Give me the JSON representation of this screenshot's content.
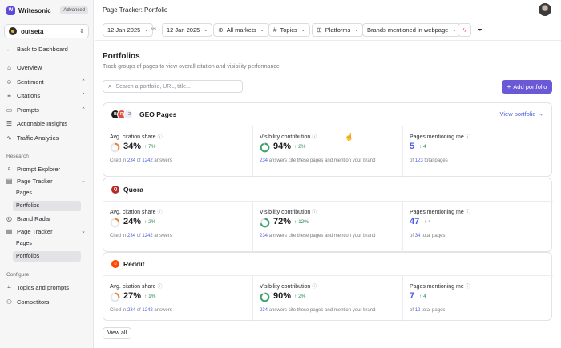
{
  "app": {
    "name": "Writesonic",
    "plan_badge": "Advanced",
    "workspace": "outseta"
  },
  "sidebar": {
    "back": "Back to Dashboard",
    "items": [
      {
        "label": "Overview",
        "icon": "home-icon"
      },
      {
        "label": "Sentiment",
        "icon": "sentiment-icon",
        "expandable": true
      },
      {
        "label": "Citations",
        "icon": "citations-icon",
        "expandable": true
      },
      {
        "label": "Prompts",
        "icon": "prompts-icon",
        "expandable": true
      },
      {
        "label": "Actionable Insights",
        "icon": "insights-icon"
      },
      {
        "label": "Traffic Analytics",
        "icon": "analytics-icon"
      }
    ],
    "research_title": "Research",
    "research_items": [
      {
        "label": "Prompt Explorer",
        "icon": "explorer-icon"
      },
      {
        "label": "Page Tracker",
        "icon": "tracker-icon",
        "expandable": true,
        "children": [
          "Pages",
          "Portfolios"
        ]
      },
      {
        "label": "Brand Radar",
        "icon": "radar-icon"
      },
      {
        "label": "Page Tracker",
        "icon": "tracker-icon",
        "expandable": true,
        "children": [
          "Pages",
          "Portfolios"
        ]
      }
    ],
    "configure_title": "Configure",
    "configure_items": [
      {
        "label": "Topics and prompts",
        "icon": "topics-icon"
      },
      {
        "label": "Competitors",
        "icon": "competitors-icon"
      }
    ]
  },
  "header": {
    "breadcrumb": "Page Tracker: Portfolio"
  },
  "filters": {
    "date_from": "12 Jan 2025",
    "vs_label": "vs.",
    "date_to": "12 Jan 2025",
    "markets": "All markets",
    "topics": "Topics",
    "platforms": "Platforms",
    "brands": "Brands mentioned in webpage"
  },
  "main": {
    "title": "Portfolios",
    "subtitle": "Track groups of pages to view overall citation and visibility performance",
    "search_placeholder": "Search a portfolio, URL, title...",
    "add_button": "Add portfolio",
    "view_all": "View all"
  },
  "metric_labels": {
    "citation": "Avg. citation share",
    "visibility": "Visibility contribution",
    "pages": "Pages mentioning me"
  },
  "colors": {
    "accent": "#6a59d6",
    "link": "#4b5ee0",
    "positive": "#2e8b57",
    "ring_orange": "#e8893a",
    "ring_green": "#3aa36b"
  },
  "portfolios": [
    {
      "name": "GEO Pages",
      "logo": "multi-logo",
      "extra_count": "+2",
      "view_link": "View portfolio",
      "citation": {
        "value": "34%",
        "fill": 0.34,
        "delta": "7%",
        "foot_pre": "Cited in",
        "cited": "234",
        "foot_mid": "of",
        "total": "1242",
        "foot_post": "answers"
      },
      "visibility": {
        "value": "94%",
        "fill": 0.94,
        "delta": "2%",
        "count": "234",
        "foot": "answers cite these pages and mention your brand"
      },
      "pages": {
        "value": "5",
        "delta": "4",
        "foot_pre": "of",
        "total": "123",
        "foot_post": "total pages"
      }
    },
    {
      "name": "Quora",
      "logo": "quora-logo",
      "citation": {
        "value": "24%",
        "fill": 0.24,
        "delta": "2%",
        "foot_pre": "Cited in",
        "cited": "234",
        "foot_mid": "of",
        "total": "1242",
        "foot_post": "answers"
      },
      "visibility": {
        "value": "72%",
        "fill": 0.72,
        "delta": "12%",
        "count": "234",
        "foot": "answers cite these pages and mention your brand"
      },
      "pages": {
        "value": "47",
        "delta": "4",
        "foot_pre": "of",
        "total": "34",
        "foot_post": "total pages"
      }
    },
    {
      "name": "Reddit",
      "logo": "reddit-logo",
      "citation": {
        "value": "27%",
        "fill": 0.27,
        "delta": "1%",
        "foot_pre": "Cited in",
        "cited": "234",
        "foot_mid": "of",
        "total": "1242",
        "foot_post": "answers"
      },
      "visibility": {
        "value": "90%",
        "fill": 0.9,
        "delta": "2%",
        "count": "234",
        "foot": "answers cite these pages and mention your brand"
      },
      "pages": {
        "value": "7",
        "delta": "4",
        "foot_pre": "of",
        "total": "12",
        "foot_post": "total pages"
      }
    }
  ]
}
